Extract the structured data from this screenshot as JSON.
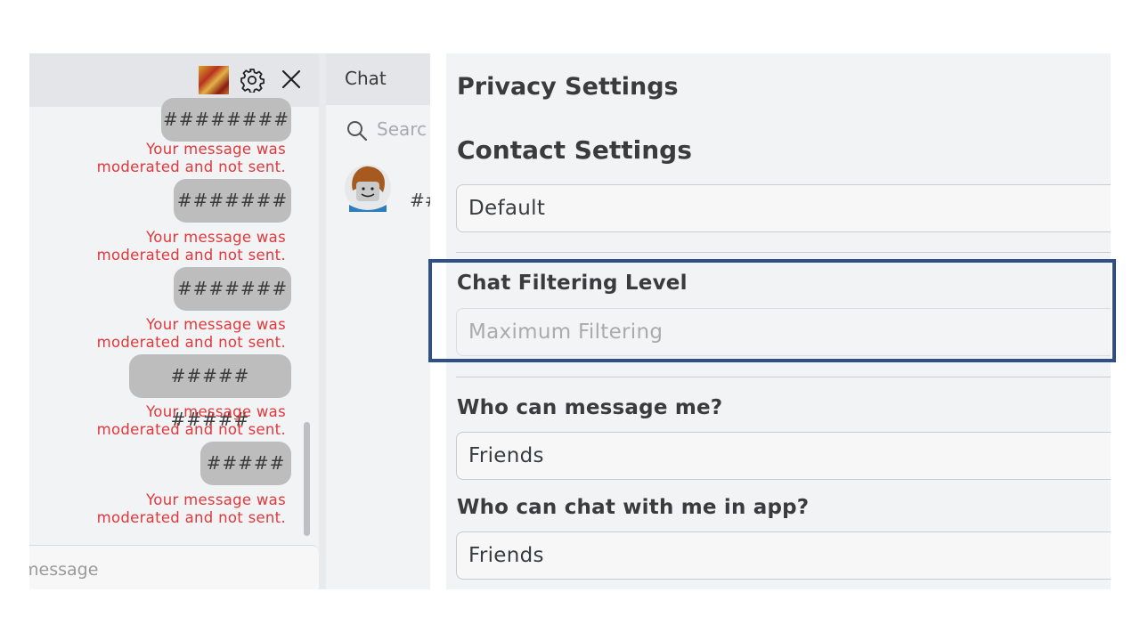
{
  "conversation": {
    "placeholder": "message",
    "messages": [
      {
        "text": "########",
        "status": "Your message was moderated and not sent."
      },
      {
        "text": "#######",
        "status": "Your message was moderated and not sent."
      },
      {
        "text": "#######",
        "status": "Your message was moderated and not sent."
      },
      {
        "text": "##### #####",
        "status": "Your message was moderated and not sent."
      },
      {
        "text": "#####",
        "status": "Your message was moderated and not sent."
      }
    ]
  },
  "chat_list": {
    "title": "Chat",
    "search_placeholder": "Searc",
    "preview": "##"
  },
  "settings": {
    "privacy_title": "Privacy Settings",
    "contact_title": "Contact Settings",
    "contact_value": "Default",
    "filter_label": "Chat Filtering Level",
    "filter_value": "Maximum Filtering",
    "message_label": "Who can message me?",
    "message_value": "Friends",
    "chat_label": "Who can chat with me in app?",
    "chat_value": "Friends"
  },
  "colors": {
    "moderation_text": "#e0383b",
    "highlight_border": "#2f4f8a",
    "bubble": "#bdbdbd"
  },
  "icons": [
    "gear-icon",
    "close-icon",
    "search-icon",
    "avatar-thumbnail"
  ]
}
